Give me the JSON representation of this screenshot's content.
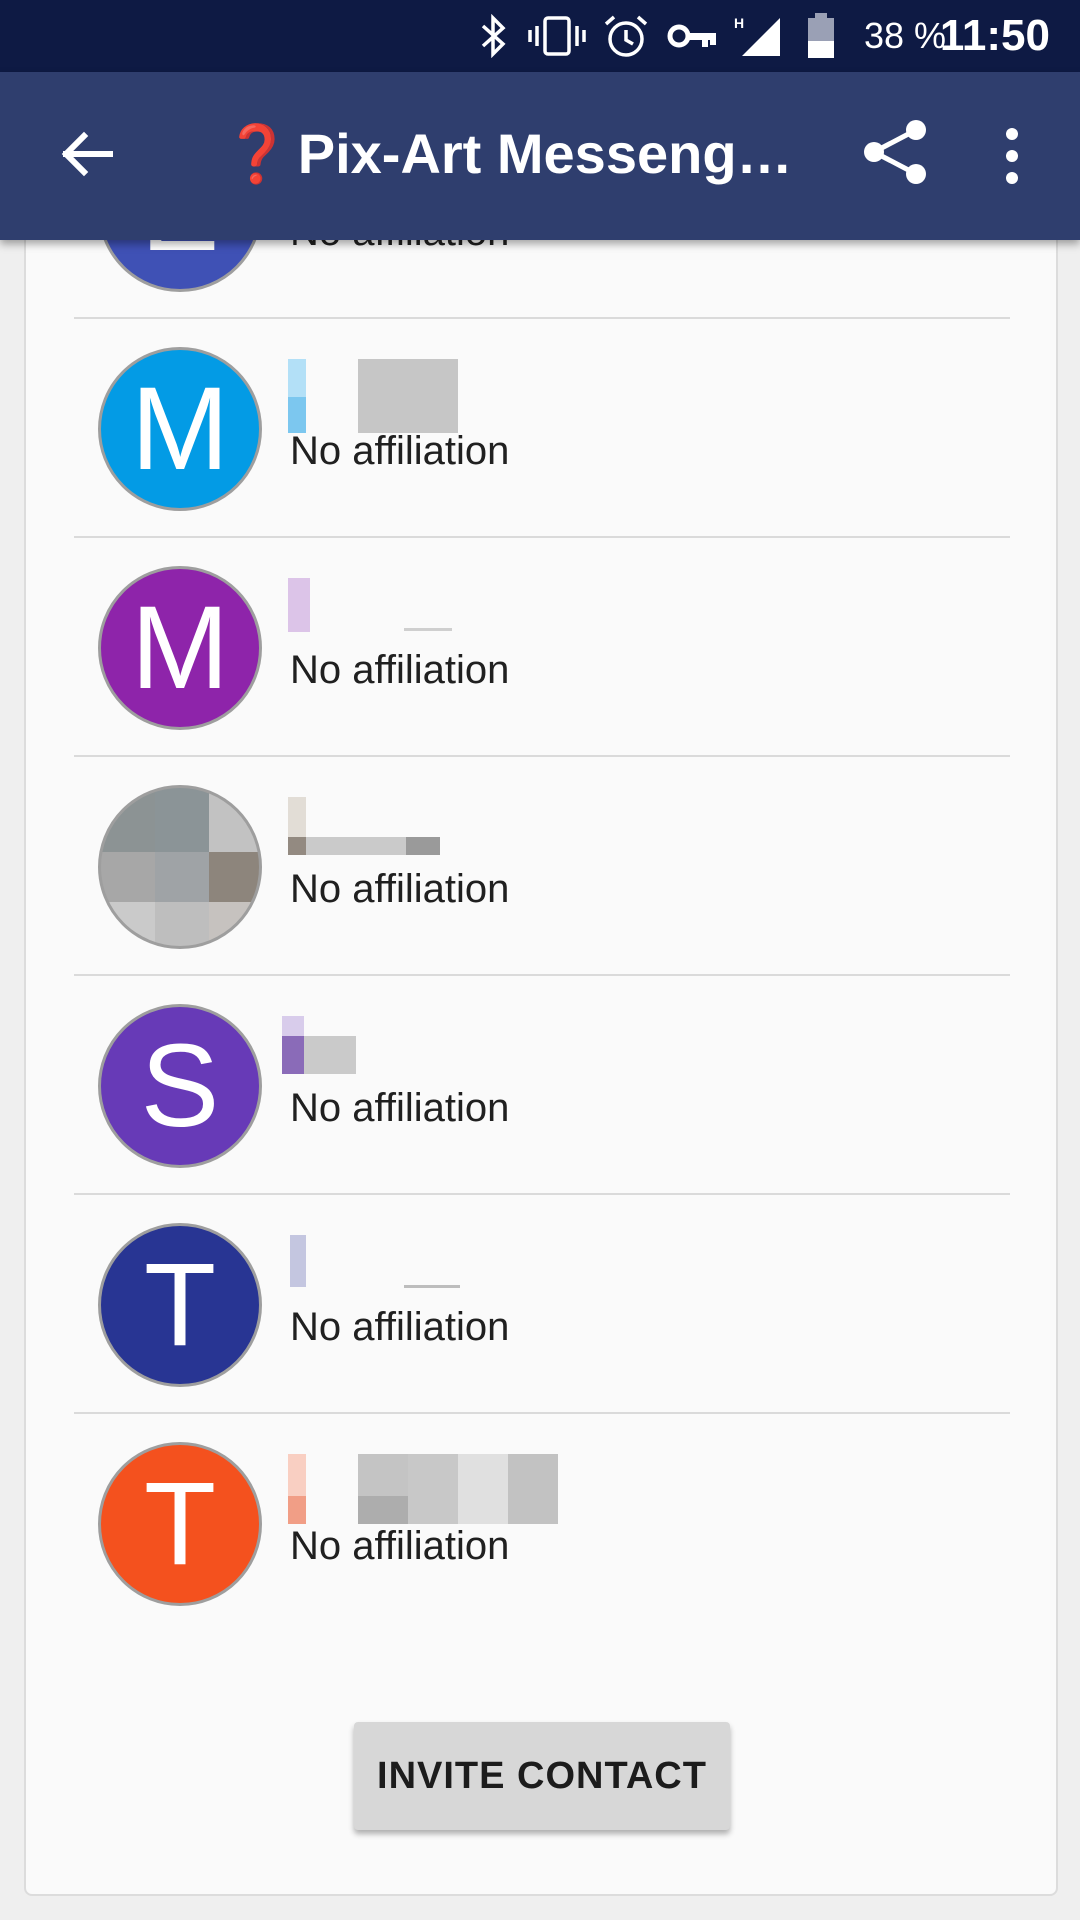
{
  "status_bar": {
    "icons": [
      "bluetooth-icon",
      "vibrate-icon",
      "alarm-icon",
      "vpn-key-icon",
      "signal-h-icon",
      "battery-icon"
    ],
    "network_type": "H",
    "battery_percent": "38 %",
    "time": "11:50"
  },
  "toolbar": {
    "title_emoji": "❓",
    "title": "Pix-Art Messenge…",
    "back_icon": "arrow-left-icon",
    "share_icon": "share-icon",
    "more_icon": "more-vert-icon",
    "background_color": "#2f3e6e"
  },
  "participants": [
    {
      "initial": "E",
      "color": "#3f51b5",
      "subtitle": "No affiliation"
    },
    {
      "initial": "M",
      "color": "#039be5",
      "subtitle": "No affiliation"
    },
    {
      "initial": "M",
      "color": "#8e24aa",
      "subtitle": "No affiliation"
    },
    {
      "initial": "",
      "color": "#9e9e9e",
      "subtitle": "No affiliation",
      "photo": true
    },
    {
      "initial": "S",
      "color": "#673ab7",
      "subtitle": "No affiliation"
    },
    {
      "initial": "T",
      "color": "#283593",
      "subtitle": "No affiliation"
    },
    {
      "initial": "T",
      "color": "#f4511e",
      "subtitle": "No affiliation"
    }
  ],
  "invite_button": {
    "label": "INVITE CONTACT"
  }
}
